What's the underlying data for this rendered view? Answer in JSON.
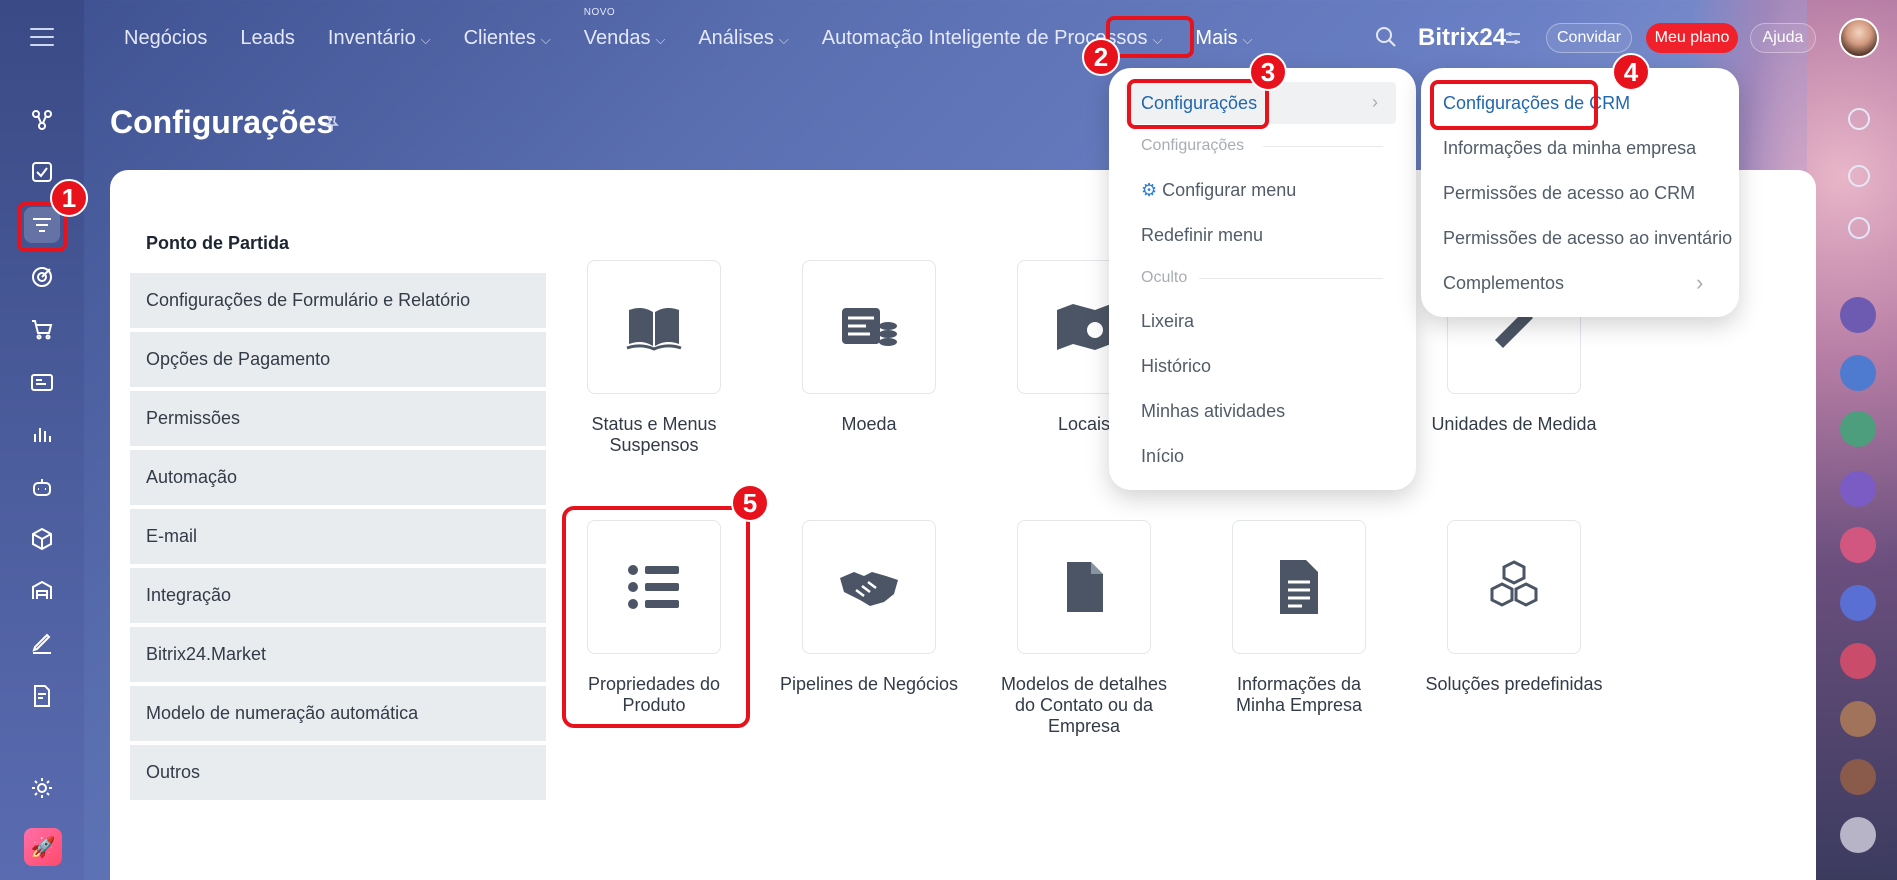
{
  "topnav": {
    "items": [
      {
        "label": "Negócios",
        "chev": false
      },
      {
        "label": "Leads",
        "chev": false
      },
      {
        "label": "Inventário",
        "chev": true
      },
      {
        "label": "Clientes",
        "chev": true
      },
      {
        "label": "Vendas",
        "chev": true,
        "tag": "NOVO"
      },
      {
        "label": "Análises",
        "chev": true
      },
      {
        "label": "Automação Inteligente de Processos",
        "chev": true
      },
      {
        "label": "Mais",
        "chev": true
      }
    ],
    "brand": "Bitrix24",
    "invite": "Convidar",
    "plan": "Meu plano",
    "help": "Ajuda"
  },
  "page": {
    "title": "Configurações"
  },
  "left_panel": {
    "title": "Ponto de Partida",
    "items": [
      "Configurações de Formulário e Relatório",
      "Opções de Pagamento",
      "Permissões",
      "Automação",
      "E-mail",
      "Integração",
      "Bitrix24.Market",
      "Modelo de numeração automática",
      "Outros"
    ]
  },
  "tiles": [
    {
      "label_1": "Status e Menus",
      "label_2": "Suspensos",
      "icon": "book-icon"
    },
    {
      "label_1": "Moeda",
      "label_2": "",
      "icon": "currency-icon"
    },
    {
      "label_1": "Locais",
      "label_2": "",
      "icon": "map-icon"
    },
    {
      "label_1": "Unidades de Medida",
      "label_2": "",
      "icon": "ruler-icon"
    },
    {
      "label_1": "Propriedades do",
      "label_2": "Produto",
      "icon": "list-icon"
    },
    {
      "label_1": "Pipelines de Negócios",
      "label_2": "",
      "icon": "handshake-icon"
    },
    {
      "label_1": "Modelos de detalhes",
      "label_2": "do Contato ou da",
      "label_3": "Empresa",
      "icon": "file-icon"
    },
    {
      "label_1": "Informações da",
      "label_2": "Minha Empresa",
      "icon": "document-icon"
    },
    {
      "label_1": "Soluções predefinidas",
      "label_2": "",
      "icon": "cubes-icon"
    }
  ],
  "mais_menu": {
    "item_settings": "Configurações",
    "section_settings": "Configurações",
    "configure_menu": "Configurar menu",
    "reset_menu": "Redefinir menu",
    "section_hidden": "Oculto",
    "trash": "Lixeira",
    "history": "Histórico",
    "my_activities": "Minhas atividades",
    "start": "Início"
  },
  "submenu": {
    "crm_settings": "Configurações de CRM",
    "company_info": "Informações da minha empresa",
    "crm_permissions": "Permissões de acesso ao CRM",
    "inventory_permissions": "Permissões de acesso ao inventário",
    "addons": "Complementos"
  },
  "annotations": [
    "1",
    "2",
    "3",
    "4",
    "5"
  ],
  "colors": {
    "highlight": "#e8121c",
    "link_blue": "#2067b0",
    "plan_red": "#f0212a"
  }
}
